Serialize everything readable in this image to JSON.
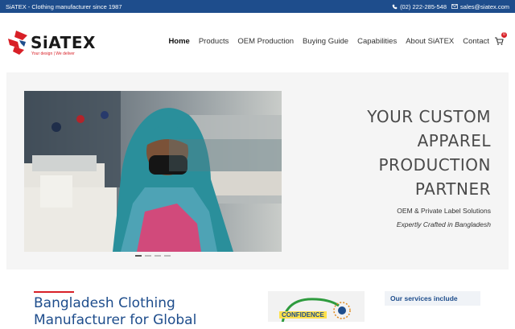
{
  "topbar": {
    "tagline": "SiATEX - Clothing manufacturer since 1987",
    "phone": "(02) 222-285-548",
    "email": "sales@siatex.com"
  },
  "logo": {
    "word": "SiATEX",
    "tagline": "Your design | We deliver"
  },
  "nav": {
    "items": [
      "Home",
      "Products",
      "OEM Production",
      "Buying Guide",
      "Capabilities",
      "About SiATEX",
      "Contact"
    ]
  },
  "cart": {
    "count": "0"
  },
  "hero": {
    "title_lines": [
      "YOUR CUSTOM",
      "APPAREL",
      "PRODUCTION",
      "PARTNER"
    ],
    "subtitle": "OEM & Private Label Solutions",
    "subtitle2": "Expertly Crafted in Bangladesh",
    "slide_count": 4,
    "active_slide": 1
  },
  "intro": {
    "title": "Bangladesh Clothing Manufacturer for Global"
  },
  "badge": {
    "label": "CONFIDENCE"
  },
  "services": {
    "heading": "Our services include"
  },
  "colors": {
    "brand_blue": "#1e4d8c",
    "brand_red": "#d82027"
  }
}
